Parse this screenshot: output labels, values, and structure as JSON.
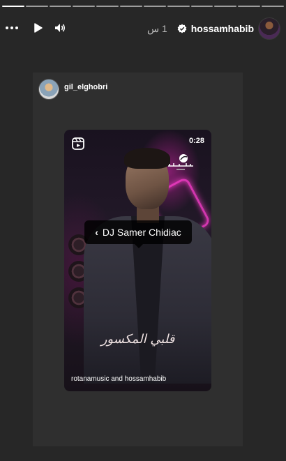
{
  "story": {
    "segments": 12,
    "active_segment": 0
  },
  "header": {
    "username": "hossamhabib",
    "time_ago": "1 س",
    "icons": [
      "more-icon",
      "play-icon",
      "volume-icon",
      "verified-badge-icon"
    ]
  },
  "shared_post": {
    "sharer": "gil_elghobri",
    "reel": {
      "duration": "0:28",
      "tagged_user": "DJ Samer Chidiac",
      "song_title": "قلبي المكسور",
      "credits": "rotanamusic and hossamhabib",
      "icons": [
        "reels-icon",
        "rotana-logo-icon",
        "chevron-left-icon"
      ]
    }
  },
  "colors": {
    "background": "#272727",
    "card": "#2f2f2f",
    "neon": "#ff3ed0"
  }
}
